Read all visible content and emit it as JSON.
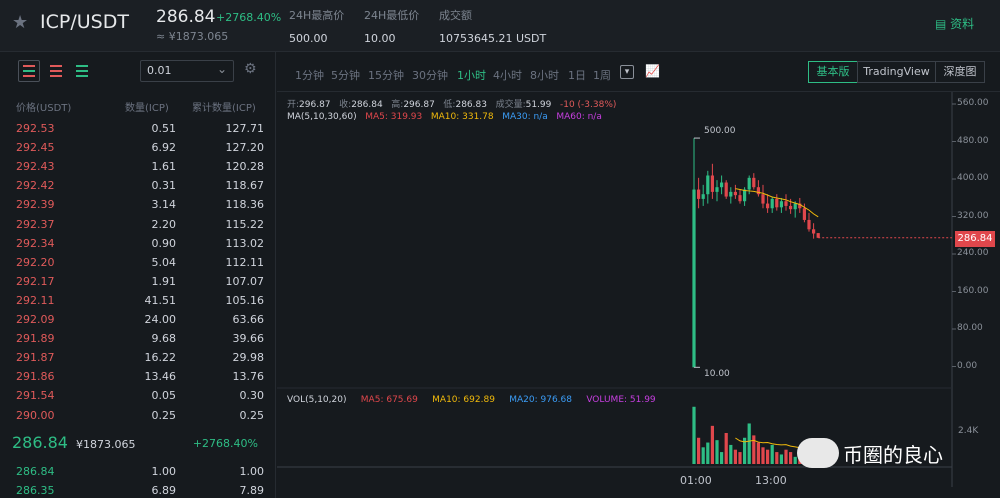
{
  "header": {
    "pair": "ICP/USDT",
    "price": "286.84",
    "change": "+2768.40%",
    "cny": "≈ ¥1873.065",
    "stats": [
      {
        "label": "24H最高价",
        "value": "500.00"
      },
      {
        "label": "24H最低价",
        "value": "10.00"
      },
      {
        "label": "成交额",
        "value": "10753645.21 USDT"
      }
    ],
    "info_label": "资料"
  },
  "orderbook": {
    "precision": "0.01",
    "headers": {
      "price": "价格(USDT)",
      "qty": "数量(ICP)",
      "total": "累计数量(ICP)"
    },
    "asks": [
      [
        "292.53",
        "0.51",
        "127.71"
      ],
      [
        "292.45",
        "6.92",
        "127.20"
      ],
      [
        "292.43",
        "1.61",
        "120.28"
      ],
      [
        "292.42",
        "0.31",
        "118.67"
      ],
      [
        "292.39",
        "3.14",
        "118.36"
      ],
      [
        "292.37",
        "2.20",
        "115.22"
      ],
      [
        "292.34",
        "0.90",
        "113.02"
      ],
      [
        "292.20",
        "5.04",
        "112.11"
      ],
      [
        "292.17",
        "1.91",
        "107.07"
      ],
      [
        "292.11",
        "41.51",
        "105.16"
      ],
      [
        "292.09",
        "24.00",
        "63.66"
      ],
      [
        "291.89",
        "9.68",
        "39.66"
      ],
      [
        "291.87",
        "16.22",
        "29.98"
      ],
      [
        "291.86",
        "13.46",
        "13.76"
      ],
      [
        "291.54",
        "0.05",
        "0.30"
      ],
      [
        "290.00",
        "0.25",
        "0.25"
      ]
    ],
    "last_price": "286.84",
    "last_cny": "¥1873.065",
    "last_change": "+2768.40%",
    "bids": [
      [
        "286.84",
        "1.00",
        "1.00"
      ],
      [
        "286.35",
        "6.89",
        "7.89"
      ]
    ]
  },
  "toolbar": {
    "timeframes": [
      "1分钟",
      "5分钟",
      "15分钟",
      "30分钟",
      "1小时",
      "4小时",
      "8小时",
      "1日",
      "1周"
    ],
    "active_timeframe": "1小时",
    "views": [
      "基本版",
      "TradingView",
      "深度图"
    ],
    "active_view": "基本版"
  },
  "legend": {
    "ohlc": {
      "open_label": "开:",
      "open": "296.87",
      "close_label": "收:",
      "close": "286.84",
      "high_label": "高:",
      "high": "296.87",
      "low_label": "低:",
      "low": "286.83",
      "vol_label": "成交量:",
      "vol": "51.99",
      "chg": "-10 (-3.38%)"
    },
    "ma_title": "MA(5,10,30,60)",
    "ma5": "MA5: 319.93",
    "ma10": "MA10: 331.78",
    "ma30": "MA30: n/a",
    "ma60": "MA60: n/a",
    "vol_title": "VOL(5,10,20)",
    "vma5": "MA5: 675.69",
    "vma10": "MA10: 692.89",
    "vma20": "MA20: 976.68",
    "volume": "VOLUME: 51.99"
  },
  "chart_data": {
    "type": "candlestick",
    "y_ticks": [
      "560.00",
      "480.00",
      "400.00",
      "320.00",
      "240.00",
      "160.00",
      "80.00",
      "0.00"
    ],
    "ylim": [
      0,
      560
    ],
    "vol_tick": "2.4K",
    "x_ticks": [
      "01:00",
      "13:00"
    ],
    "max_label": "500.00",
    "min_label": "10.00",
    "current_price": "286.84",
    "colors": {
      "up": "#2ebd85",
      "down": "#e0474c",
      "ma5": "#e0474c",
      "ma10": "#f0b90b",
      "ma30": "#3b9cf5",
      "ma60": "#c73fe0"
    },
    "candles": [
      [
        10,
        500,
        10,
        390
      ],
      [
        390,
        415,
        350,
        370
      ],
      [
        370,
        400,
        355,
        380
      ],
      [
        380,
        430,
        360,
        420
      ],
      [
        420,
        445,
        370,
        385
      ],
      [
        385,
        410,
        365,
        395
      ],
      [
        395,
        420,
        380,
        405
      ],
      [
        405,
        410,
        370,
        375
      ],
      [
        375,
        395,
        360,
        385
      ],
      [
        385,
        400,
        370,
        378
      ],
      [
        378,
        390,
        360,
        365
      ],
      [
        365,
        395,
        355,
        390
      ],
      [
        390,
        420,
        380,
        415
      ],
      [
        415,
        425,
        390,
        395
      ],
      [
        395,
        410,
        375,
        380
      ],
      [
        380,
        400,
        350,
        360
      ],
      [
        360,
        380,
        340,
        350
      ],
      [
        350,
        375,
        340,
        370
      ],
      [
        370,
        380,
        345,
        352
      ],
      [
        352,
        372,
        340,
        365
      ],
      [
        365,
        380,
        345,
        355
      ],
      [
        355,
        370,
        338,
        348
      ],
      [
        348,
        365,
        330,
        360
      ],
      [
        360,
        372,
        340,
        350
      ],
      [
        350,
        360,
        320,
        325
      ],
      [
        325,
        340,
        300,
        305
      ],
      [
        305,
        318,
        285,
        296
      ],
      [
        296.87,
        296.87,
        286.83,
        286.84
      ]
    ],
    "ma10_line": [
      null,
      null,
      null,
      null,
      null,
      null,
      null,
      null,
      null,
      392,
      390,
      388,
      387,
      386,
      384,
      382,
      378,
      374,
      372,
      370,
      368,
      364,
      361,
      358,
      352,
      346,
      338,
      331.78
    ],
    "volumes": [
      2400,
      1100,
      700,
      900,
      1600,
      1000,
      500,
      1300,
      800,
      600,
      500,
      1100,
      1700,
      1200,
      900,
      700,
      600,
      800,
      500,
      400,
      600,
      500,
      300,
      400,
      600,
      700,
      400,
      52
    ],
    "vol_ma10": [
      null,
      null,
      null,
      null,
      null,
      null,
      null,
      null,
      null,
      1090,
      970,
      930,
      960,
      990,
      920,
      890,
      900,
      850,
      820,
      800,
      810,
      750,
      720,
      680,
      660,
      670,
      660,
      610
    ]
  }
}
